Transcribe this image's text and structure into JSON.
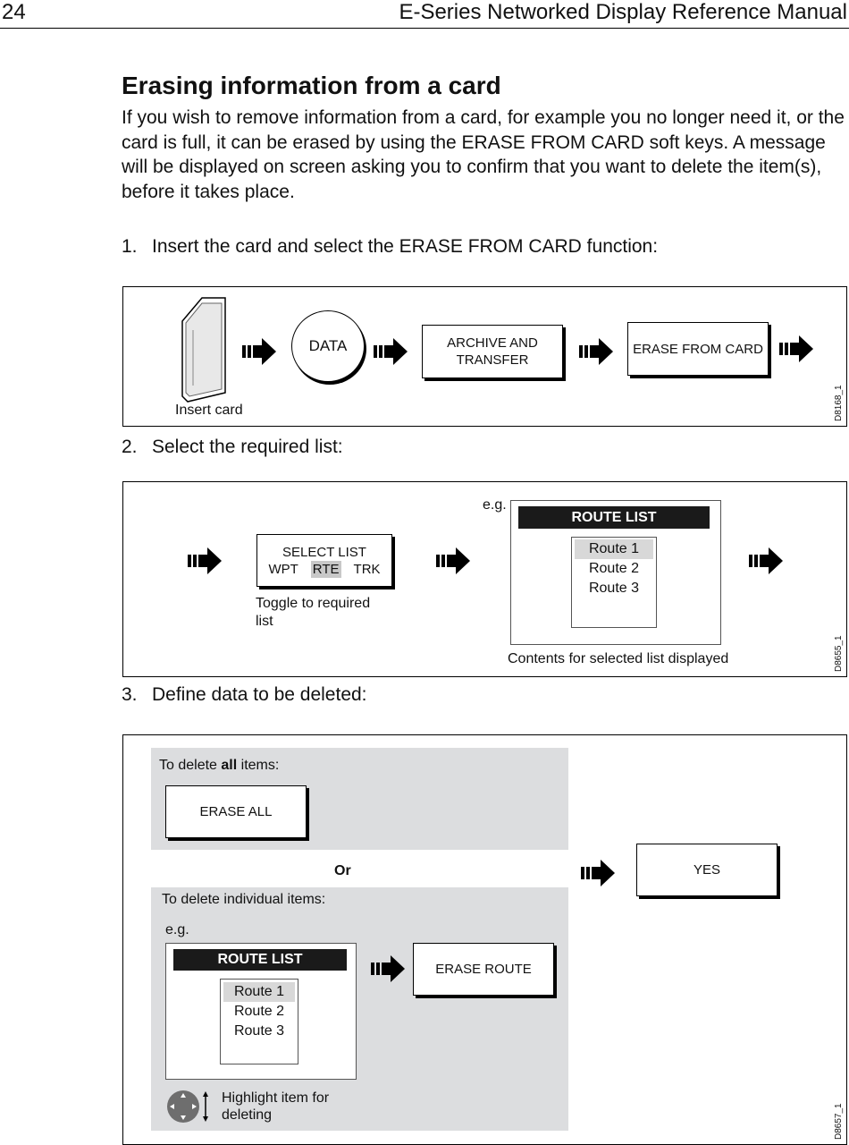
{
  "header": {
    "page_number": "24",
    "manual_title": "E-Series Networked Display Reference Manual"
  },
  "section": {
    "title": "Erasing information from a card",
    "intro": "If you wish to remove information from a card, for example you no longer need it, or the card is full, it can be erased by using the ERASE FROM CARD soft keys. A message will be displayed on screen asking you to confirm that you want to delete the item(s), before it takes place."
  },
  "steps": [
    {
      "number": "1.",
      "text": "Insert the card and select the ERASE FROM CARD function:"
    },
    {
      "number": "2.",
      "text": "Select the required list:"
    },
    {
      "number": "3.",
      "text": "Define data to be deleted:"
    }
  ],
  "figure1": {
    "id": "D8168_1",
    "card_label": "Insert card",
    "data_key": "DATA",
    "archive_key": "ARCHIVE AND TRANSFER",
    "erase_key": "ERASE FROM CARD"
  },
  "figure2": {
    "id": "D8655_1",
    "select_list_title": "SELECT LIST",
    "options": [
      "WPT",
      "RTE",
      "TRK"
    ],
    "selected_option": "RTE",
    "toggle_caption": "Toggle to required list",
    "eg_label": "e.g.",
    "route_list_title": "ROUTE LIST",
    "routes": [
      "Route 1",
      "Route 2",
      "Route 3"
    ],
    "selected_route": "Route 1",
    "contents_caption": "Contents for selected list displayed"
  },
  "figure3": {
    "id": "D8657_1",
    "delete_all_prefix": "To delete ",
    "delete_all_bold": "all",
    "delete_all_suffix": " items:",
    "erase_all_key": "ERASE ALL",
    "or_label": "Or",
    "yes_key": "YES",
    "delete_individual_label": "To delete individual items:",
    "eg_label": "e.g.",
    "route_list_title": "ROUTE LIST",
    "routes": [
      "Route 1",
      "Route 2",
      "Route 3"
    ],
    "erase_route_key": "ERASE ROUTE",
    "highlight_caption": "Highlight item for deleting"
  }
}
